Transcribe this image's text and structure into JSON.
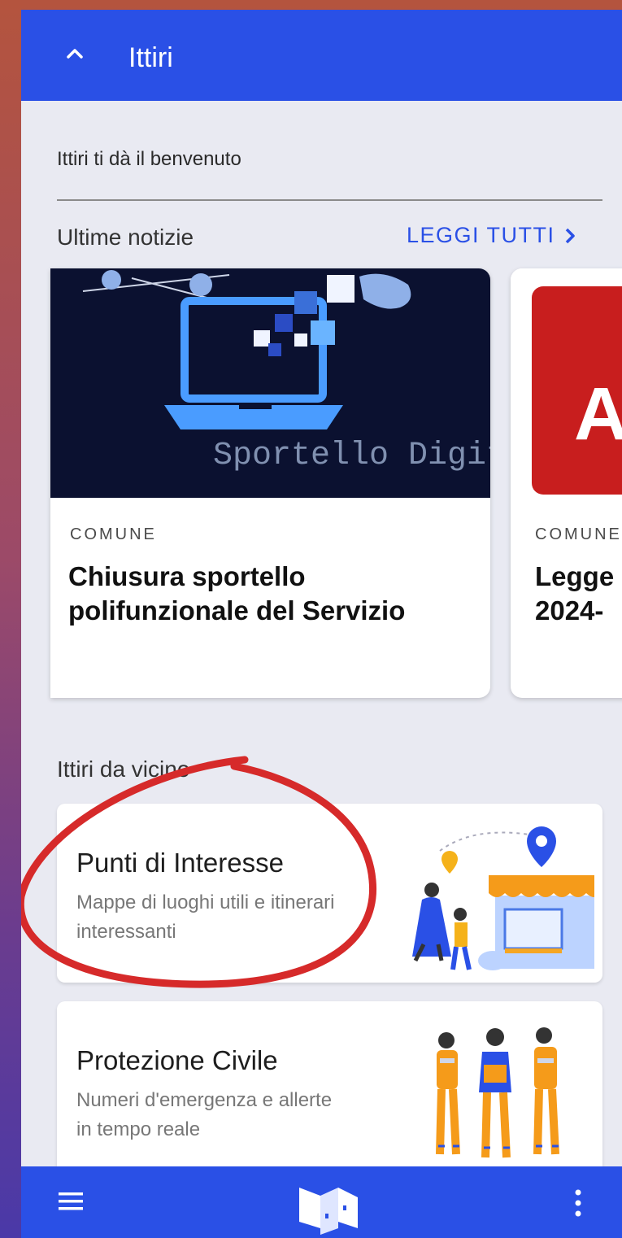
{
  "app": {
    "title": "Ittiri"
  },
  "welcome_text": "Ittiri ti dà il benvenuto",
  "news": {
    "heading": "Ultime notizie",
    "read_all": "LEGGI TUTTI",
    "cards": [
      {
        "category": "COMUNE",
        "title": "Chiusura sportello\npolifunzionale del Servizio",
        "image_text": "Sportello\nDigitITTIRI"
      },
      {
        "category": "COMUNE",
        "title": "Legge\n2024-",
        "image_text": "A"
      }
    ]
  },
  "near": {
    "heading": "Ittiri da vicino",
    "tiles": [
      {
        "title": "Punti di Interesse",
        "desc": "Mappe di luoghi utili e itinerari interessanti"
      },
      {
        "title": "Protezione Civile",
        "desc": "Numeri d'emergenza e allerte in tempo reale"
      }
    ]
  },
  "colors": {
    "primary": "#2a50e6",
    "background": "#e9eaf2",
    "annotation": "#d62a2a"
  },
  "icons": [
    "chevron-up-icon",
    "chevron-right-icon",
    "hamburger-menu-icon",
    "app-logo-icon",
    "more-vertical-icon"
  ]
}
